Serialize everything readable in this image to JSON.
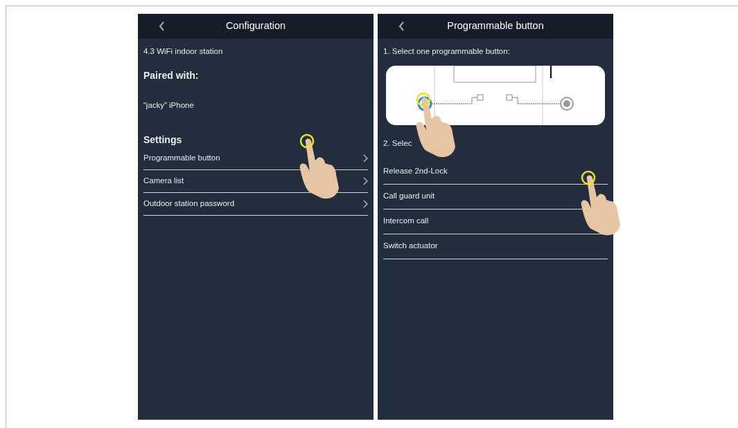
{
  "screens": [
    {
      "title": "Configuration",
      "device_name": "4.3 WiFi indoor station",
      "paired_heading": "Paired with:",
      "paired_device": "“jacky” iPhone",
      "settings_heading": "Settings",
      "settings_items": [
        {
          "label": "Programmable button"
        },
        {
          "label": "Camera list"
        },
        {
          "label": "Outdoor station password"
        }
      ]
    },
    {
      "title": "Programmable button",
      "step_1": "1. Select one programmable button:",
      "step_2": "2. Selec",
      "options": [
        {
          "label": "Release 2nd-Lock"
        },
        {
          "label": "Call guard unit"
        },
        {
          "label": "Intercom call"
        },
        {
          "label": "Switch actuator"
        }
      ]
    }
  ]
}
